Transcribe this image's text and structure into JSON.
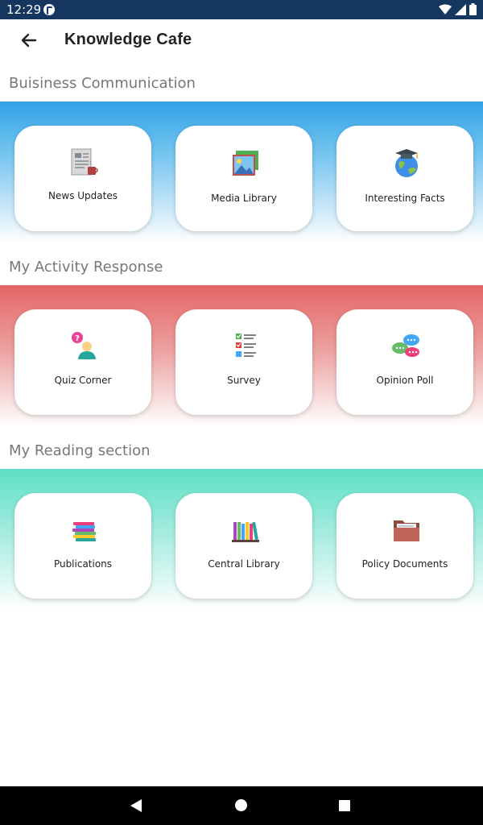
{
  "status_bar": {
    "time": "12:29"
  },
  "app_bar": {
    "title": "Knowledge Cafe"
  },
  "sections": [
    {
      "title": "Buisiness Communication",
      "items": [
        {
          "label": "News Updates",
          "icon": "newspaper-icon"
        },
        {
          "label": "Media Library",
          "icon": "media-gallery-icon"
        },
        {
          "label": "Interesting Facts",
          "icon": "globe-graduation-icon"
        }
      ]
    },
    {
      "title": "My Activity Response",
      "items": [
        {
          "label": "Quiz Corner",
          "icon": "question-person-icon"
        },
        {
          "label": "Survey",
          "icon": "checklist-icon"
        },
        {
          "label": "Opinion Poll",
          "icon": "chat-bubbles-icon"
        }
      ]
    },
    {
      "title": "My Reading section",
      "items": [
        {
          "label": "Publications",
          "icon": "stacked-books-icon"
        },
        {
          "label": "Central Library",
          "icon": "bookshelf-icon"
        },
        {
          "label": "Policy Documents",
          "icon": "folder-icon"
        }
      ]
    }
  ],
  "colors": {
    "status_bar": "#14365f",
    "band_business": "#2fa3e6",
    "band_activity": "#e56565",
    "band_reading": "#5ddfc5"
  }
}
